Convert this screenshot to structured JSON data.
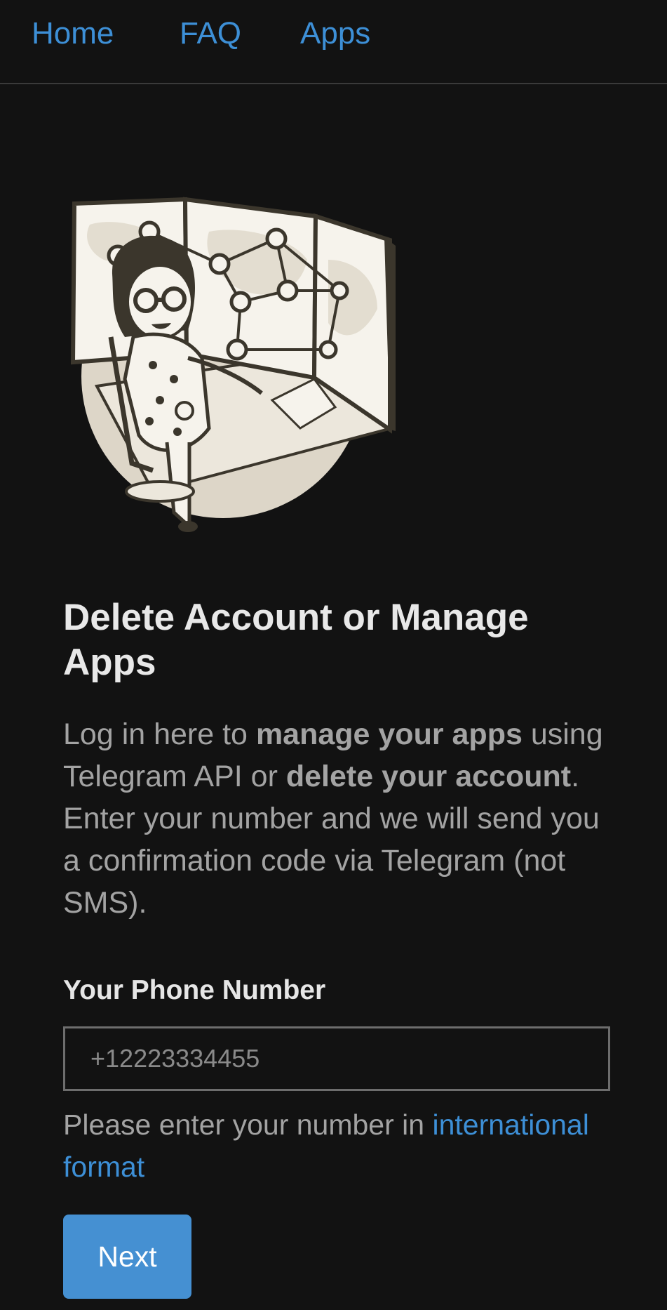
{
  "nav": {
    "home": "Home",
    "faq": "FAQ",
    "apps": "Apps"
  },
  "illustration": {
    "icon": "woman-at-desk-network-map-illustration"
  },
  "main": {
    "title": "Delete Account or Manage Apps",
    "intro": {
      "part1": "Log in here to ",
      "bold1": "manage your apps",
      "part2": " using Telegram API or ",
      "bold2": "delete your account",
      "part3": ". Enter your number and we will send you a confirmation code via Telegram (not SMS)."
    },
    "phone_label": "Your Phone Number",
    "phone_placeholder": "+12223334455",
    "hint_text": "Please enter your number in ",
    "hint_link": "international format",
    "next_label": "Next"
  },
  "colors": {
    "background": "#121212",
    "link": "#3d8fd6",
    "button": "#4590d2"
  }
}
